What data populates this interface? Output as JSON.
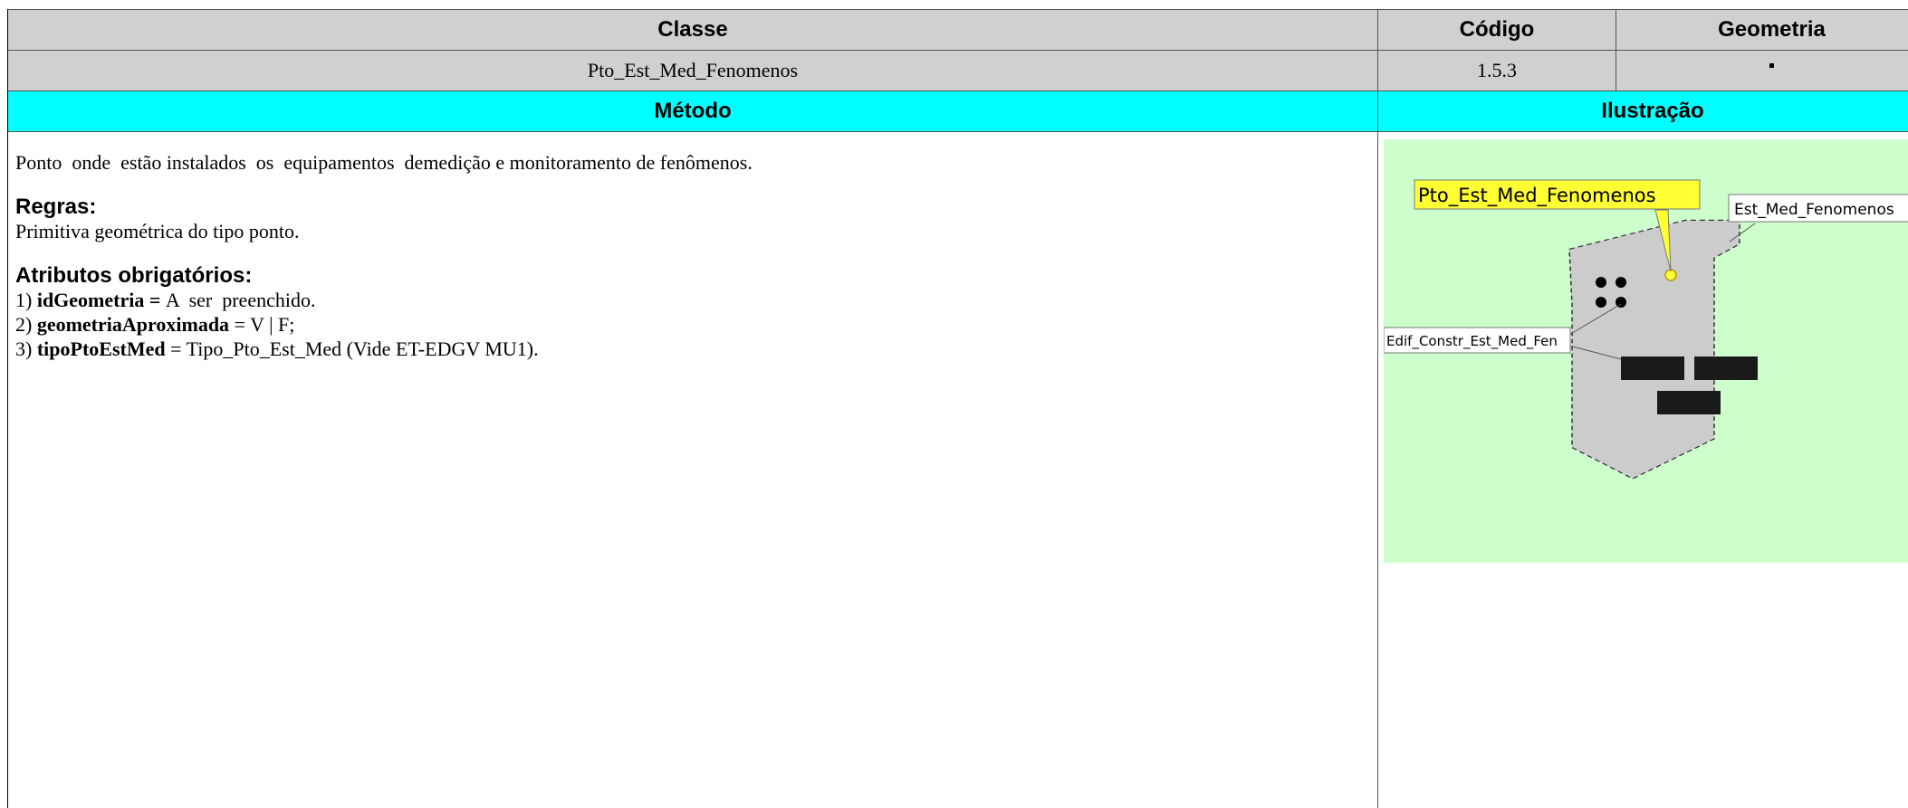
{
  "header": {
    "classe_label": "Classe",
    "codigo_label": "Código",
    "geometria_label": "Geometria"
  },
  "record": {
    "classe": "Pto_Est_Med_Fenomenos",
    "codigo": "1.5.3"
  },
  "section_header": {
    "metodo_label": "Método",
    "ilustracao_label": "Ilustração"
  },
  "method": {
    "description": "Ponto  onde  estão instalados  os  equipamentos  demedição e monitoramento de fenômenos.",
    "regras_title": "Regras:",
    "regras_text": "Primitiva geométrica do tipo ponto.",
    "atributos_title": "Atributos obrigatórios:",
    "attributes": [
      {
        "num": "1)",
        "name": "idGeometria",
        "sep": " = ",
        "value": "A  ser  preenchido."
      },
      {
        "num": "2)",
        "name": "geometriaAproximada",
        "sep": " = ",
        "value": "V | F;"
      },
      {
        "num": "3)",
        "name": "tipoPtoEstMed",
        "sep": " = ",
        "value": "Tipo_Pto_Est_Med (Vide ET-EDGV MU1)."
      }
    ]
  },
  "illustration": {
    "label_point": "Pto_Est_Med_Fenomenos",
    "label_area": "Est_Med_Fenomenos",
    "label_building": "Edif_Constr_Est_Med_Fen",
    "background_color": "#ccffcc",
    "highlight_color": "#ffff33"
  },
  "colors": {
    "header_gray": "#d0d0d0",
    "section_cyan": "#00ffff"
  }
}
